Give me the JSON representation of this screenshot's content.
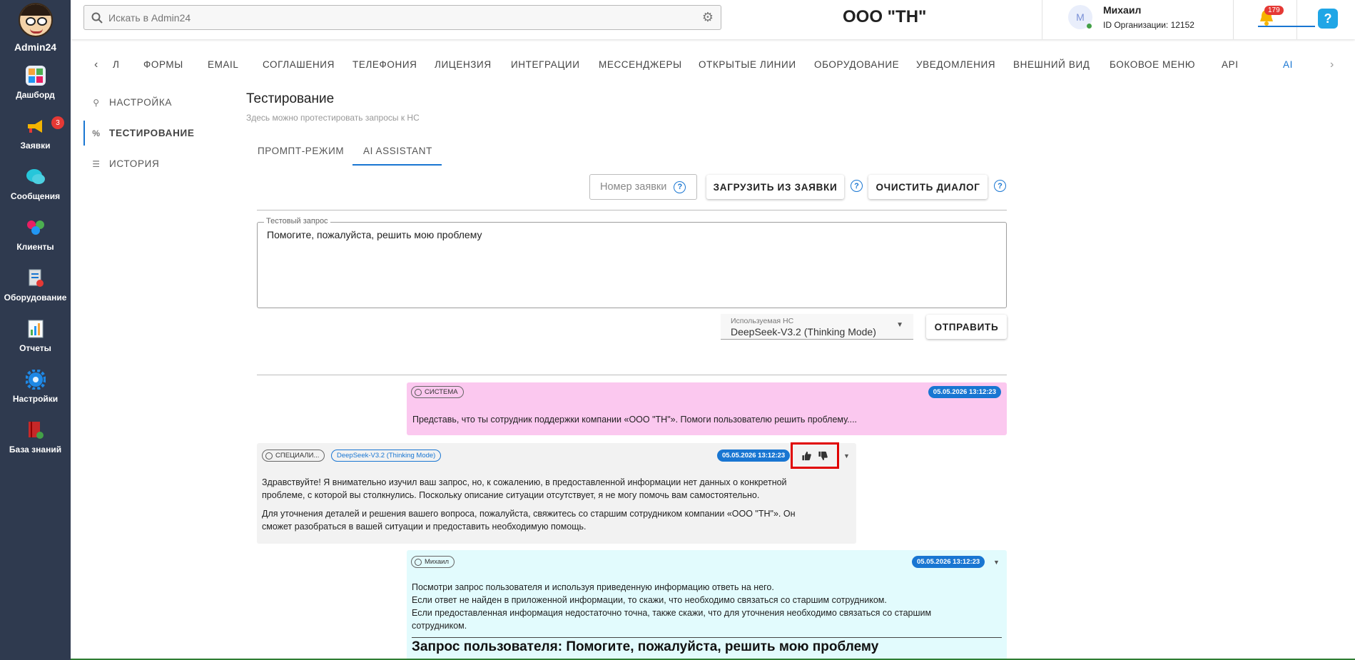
{
  "app": {
    "name": "Admin24"
  },
  "sidebar": {
    "items": [
      {
        "label": "Дашборд",
        "icon": "dashboard-icon"
      },
      {
        "label": "Заявки",
        "icon": "megaphone-icon",
        "badge": "3"
      },
      {
        "label": "Сообщения",
        "icon": "chat-icon"
      },
      {
        "label": "Клиенты",
        "icon": "clients-icon"
      },
      {
        "label": "Оборудование",
        "icon": "equipment-icon"
      },
      {
        "label": "Отчеты",
        "icon": "reports-icon"
      },
      {
        "label": "Настройки",
        "icon": "gear-icon"
      },
      {
        "label": "База знаний",
        "icon": "book-icon"
      }
    ]
  },
  "header": {
    "search_placeholder": "Искать в Admin24",
    "company": "ООО \"ТН\"",
    "user_initial": "М",
    "user_name": "Михаил",
    "org_id": "ID Организации: 12152",
    "notifications": "179",
    "help": "?"
  },
  "tabs": {
    "partial": "л",
    "items": [
      "ФОРМЫ",
      "EMAIL",
      "СОГЛАШЕНИЯ",
      "ТЕЛЕФОНИЯ",
      "ЛИЦЕНЗИЯ",
      "ИНТЕГРАЦИИ",
      "МЕССЕНДЖЕРЫ",
      "ОТКРЫТЫЕ ЛИНИИ",
      "ОБОРУДОВАНИЕ",
      "УВЕДОМЛЕНИЯ",
      "ВНЕШНИЙ ВИД",
      "БОКОВОЕ МЕНЮ",
      "API",
      "AI"
    ],
    "active": "AI"
  },
  "subnav": {
    "items": [
      "НАСТРОЙКА",
      "ТЕСТИРОВАНИЕ",
      "ИСТОРИЯ"
    ],
    "active": "ТЕСТИРОВАНИЕ"
  },
  "content": {
    "title": "Тестирование",
    "subtitle": "Здесь можно протестировать запросы к НС",
    "tabs": [
      "ПРОМПТ-РЕЖИМ",
      "AI ASSISTANT"
    ],
    "active_tab": "AI ASSISTANT",
    "ticket_number_placeholder": "Номер заявки",
    "load_button": "ЗАГРУЗИТЬ ИЗ ЗАЯВКИ",
    "clear_button": "ОЧИСТИТЬ ДИАЛОГ",
    "test_request_label": "Тестовый запрос",
    "test_request_value": "Помогите, пожалуйста, решить мою проблему",
    "model_label": "Используемая НС",
    "model_value": "DeepSeek-V3.2 (Thinking Mode)",
    "send_button": "ОТПРАВИТЬ"
  },
  "messages": [
    {
      "role": "СИСТЕМА",
      "date": "05.05.2026 13:12:23",
      "lines": [
        "Представь, что ты сотрудник поддержки компании «ООО \"ТН\"». Помоги пользователю решить проблему...."
      ],
      "color": "#fbc8ef"
    },
    {
      "role": "СПЕЦИАЛИ...",
      "model": "DeepSeek-V3.2 (Thinking Mode)",
      "date": "05.05.2026 13:12:23",
      "lines": [
        "Здравствуйте! Я внимательно изучил ваш запрос, но, к сожалению, в предоставленной информации нет данных о конкретной",
        "проблеме, с которой вы столкнулись. Поскольку описание ситуации отсутствует, я не могу помочь вам самостоятельно.",
        "Для уточнения деталей и решения вашего вопроса, пожалуйста, свяжитесь со старшим сотрудником компании «ООО \"ТН\"». Он",
        "сможет разобраться в вашей ситуации и предоставить необходимую помощь."
      ],
      "color": "#f2f2f2"
    },
    {
      "role": "Михаил",
      "date": "05.05.2026 13:12:23",
      "lines": [
        "Посмотри запрос пользователя и используя приведенную информацию ответь на него.",
        "Если ответ не найден в приложенной информации, то скажи, что необходимо связаться со старшим сотрудником.",
        "Если предоставленная информация недостаточно точна, также скажи, что для уточнения необходимо связаться со старшим",
        "сотрудником."
      ],
      "heading": "Запрос пользователя: Помогите, пожалуйста, решить мою проблему",
      "color": "#e2fbfd"
    }
  ]
}
